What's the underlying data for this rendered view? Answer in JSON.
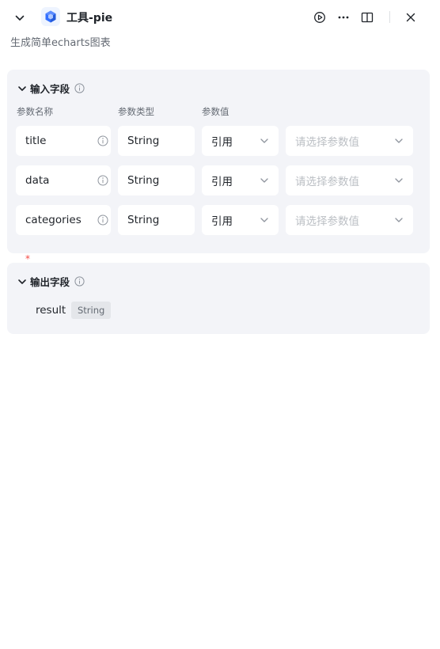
{
  "header": {
    "title": "工具-pie",
    "description": "生成简单echarts图表",
    "icons": [
      "chevron-down-icon",
      "tool-logo-icon",
      "run-icon",
      "more-icon",
      "split-view-icon",
      "close-icon"
    ]
  },
  "input_section": {
    "title": "输入字段",
    "columns": {
      "name": "参数名称",
      "type": "参数类型",
      "value": "参数值"
    },
    "rows": [
      {
        "name": "title",
        "type": "String",
        "source": "引用",
        "value_placeholder": "请选择参数值"
      },
      {
        "name": "data",
        "type": "String",
        "source": "引用",
        "value_placeholder": "请选择参数值"
      },
      {
        "name": "categories",
        "type": "String",
        "source": "引用",
        "value_placeholder": "请选择参数值"
      }
    ]
  },
  "required_mark": "*",
  "output_section": {
    "title": "输出字段",
    "fields": [
      {
        "name": "result",
        "type": "String"
      }
    ]
  },
  "colors": {
    "panel_bg": "#f3f4f8",
    "accent": "#3370ff",
    "required": "#f54a45",
    "placeholder": "#bbbfc4"
  }
}
